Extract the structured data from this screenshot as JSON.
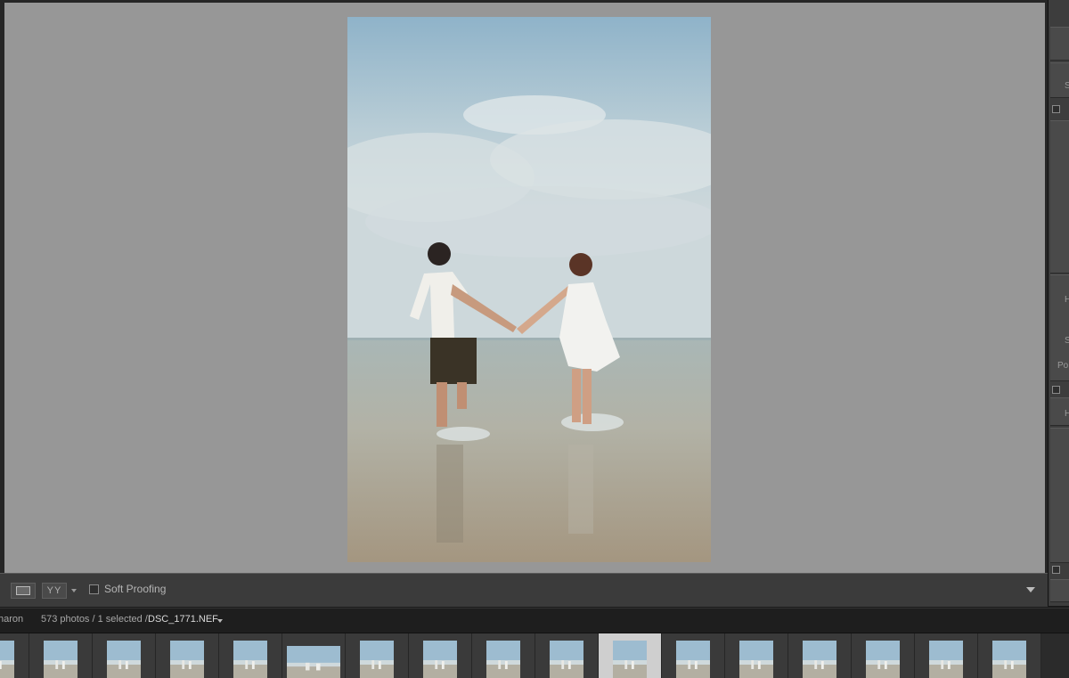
{
  "status_bar": {
    "source": "haron",
    "count": "573 photos / 1 selected /",
    "filename": "DSC_1771.NEF"
  },
  "toolbar": {
    "compare_label": "YY",
    "soft_proofing_label": "Soft Proofing",
    "soft_proofing_checked": false
  },
  "right_panel": {
    "fragments": [
      "S",
      "H",
      "S",
      "Po",
      "H"
    ]
  },
  "filmstrip": {
    "thumb_count": 17,
    "selected_index": 10
  },
  "colors": {
    "canvas": "#979797",
    "panel": "#3b3b3b",
    "info_bar": "#1e1e1e",
    "selected_cell": "#cfcfcf"
  }
}
